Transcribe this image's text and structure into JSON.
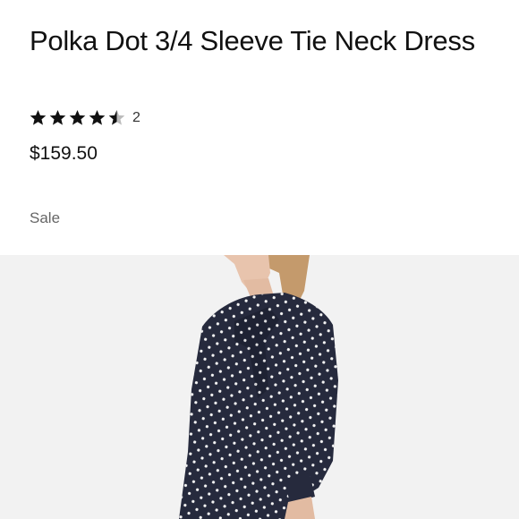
{
  "product": {
    "title": "Polka Dot 3/4 Sleeve Tie Neck Dress",
    "rating": 4.5,
    "rating_max": 5,
    "review_count": "2",
    "price": "$159.50",
    "sale_label": "Sale"
  },
  "colors": {
    "star": "#111111",
    "star_empty": "#bbbbbb",
    "dress": "#262a3d",
    "dot": "#f4f4f4",
    "photo_bg": "#f2f2f2",
    "sale_text": "#666666"
  }
}
